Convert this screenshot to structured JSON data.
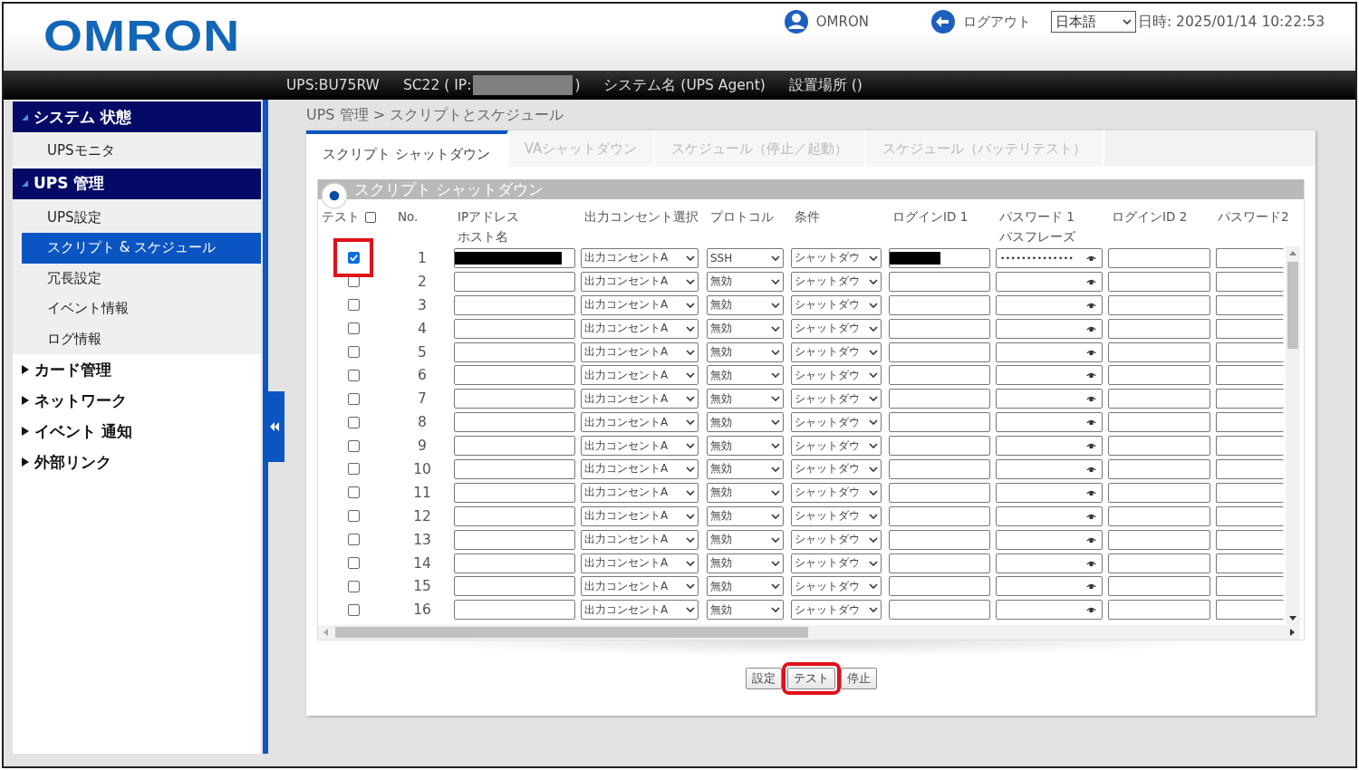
{
  "header": {
    "logo": "OMRON",
    "user": "OMRON",
    "logout": "ログアウト",
    "language": "日本語",
    "datetime": "日時: 2025/01/14 10:22:53"
  },
  "info_bar": {
    "model": "UPS:BU75RW",
    "card_prefix": "SC22 ( IP:",
    "ip_redacted": true,
    "card_suffix": ")",
    "system_name": "システム名 (UPS Agent)",
    "location": "設置場所 ()"
  },
  "sidebar": {
    "sections": [
      {
        "label": "システム 状態",
        "expanded": true,
        "items": [
          {
            "label": "UPSモニタ",
            "selected": false
          }
        ]
      },
      {
        "label": "UPS 管理",
        "expanded": true,
        "items": [
          {
            "label": "UPS設定",
            "selected": false
          },
          {
            "label": "スクリプト & スケジュール",
            "selected": true
          },
          {
            "label": "冗長設定",
            "selected": false
          },
          {
            "label": "イベント情報",
            "selected": false
          },
          {
            "label": "ログ情報",
            "selected": false
          }
        ]
      },
      {
        "label": "カード管理",
        "expanded": false
      },
      {
        "label": "ネットワーク",
        "expanded": false
      },
      {
        "label": "イベント 通知",
        "expanded": false
      },
      {
        "label": "外部リンク",
        "expanded": false
      }
    ]
  },
  "breadcrumb": "UPS 管理 > スクリプトとスケジュール",
  "tabs": [
    {
      "label": "スクリプト シャットダウン",
      "selected": true
    },
    {
      "label": "VAシャットダウン",
      "selected": false
    },
    {
      "label": "スケジュール（停止／起動）",
      "selected": false
    },
    {
      "label": "スケジュール（バッテリテスト）",
      "selected": false
    }
  ],
  "section_title": "スクリプト シャットダウン",
  "table": {
    "columns": [
      {
        "lines": [
          "テスト"
        ],
        "kind": "check"
      },
      {
        "lines": [
          "No."
        ],
        "kind": "no"
      },
      {
        "lines": [
          "IPアドレス",
          "ホスト名"
        ],
        "kind": "ip"
      },
      {
        "lines": [
          "出力コンセント選択"
        ],
        "kind": "outlet"
      },
      {
        "lines": [
          "プロトコル"
        ],
        "kind": "protocol"
      },
      {
        "lines": [
          "条件"
        ],
        "kind": "condition"
      },
      {
        "lines": [
          "ログインID 1"
        ],
        "kind": "login1"
      },
      {
        "lines": [
          "パスワード 1",
          "パスフレーズ"
        ],
        "kind": "password1"
      },
      {
        "lines": [
          "ログインID 2"
        ],
        "kind": "login2"
      },
      {
        "lines": [
          "パスワード2"
        ],
        "kind": "password2"
      }
    ],
    "select_all_checked": false,
    "rows": [
      {
        "no": "1",
        "test": true,
        "highlighted": true,
        "ip_redacted": true,
        "outlet": "出力コンセントA",
        "protocol": "SSH",
        "condition": "シャットダウ",
        "login_redacted": true,
        "password_1": "••••••••••••••"
      },
      {
        "no": "2",
        "test": false,
        "highlighted": false,
        "ip_redacted": false,
        "outlet": "出力コンセントA",
        "protocol": "無効",
        "condition": "シャットダウ",
        "login_redacted": false
      },
      {
        "no": "3",
        "test": false,
        "highlighted": false,
        "ip_redacted": false,
        "outlet": "出力コンセントA",
        "protocol": "無効",
        "condition": "シャットダウ",
        "login_redacted": false
      },
      {
        "no": "4",
        "test": false,
        "highlighted": false,
        "ip_redacted": false,
        "outlet": "出力コンセントA",
        "protocol": "無効",
        "condition": "シャットダウ",
        "login_redacted": false
      },
      {
        "no": "5",
        "test": false,
        "highlighted": false,
        "ip_redacted": false,
        "outlet": "出力コンセントA",
        "protocol": "無効",
        "condition": "シャットダウ",
        "login_redacted": false
      },
      {
        "no": "6",
        "test": false,
        "highlighted": false,
        "ip_redacted": false,
        "outlet": "出力コンセントA",
        "protocol": "無効",
        "condition": "シャットダウ",
        "login_redacted": false
      },
      {
        "no": "7",
        "test": false,
        "highlighted": false,
        "ip_redacted": false,
        "outlet": "出力コンセントA",
        "protocol": "無効",
        "condition": "シャットダウ",
        "login_redacted": false
      },
      {
        "no": "8",
        "test": false,
        "highlighted": false,
        "ip_redacted": false,
        "outlet": "出力コンセントA",
        "protocol": "無効",
        "condition": "シャットダウ",
        "login_redacted": false
      },
      {
        "no": "9",
        "test": false,
        "highlighted": false,
        "ip_redacted": false,
        "outlet": "出力コンセントA",
        "protocol": "無効",
        "condition": "シャットダウ",
        "login_redacted": false
      },
      {
        "no": "10",
        "test": false,
        "highlighted": false,
        "ip_redacted": false,
        "outlet": "出力コンセントA",
        "protocol": "無効",
        "condition": "シャットダウ",
        "login_redacted": false
      },
      {
        "no": "11",
        "test": false,
        "highlighted": false,
        "ip_redacted": false,
        "outlet": "出力コンセントA",
        "protocol": "無効",
        "condition": "シャットダウ",
        "login_redacted": false
      },
      {
        "no": "12",
        "test": false,
        "highlighted": false,
        "ip_redacted": false,
        "outlet": "出力コンセントA",
        "protocol": "無効",
        "condition": "シャットダウ",
        "login_redacted": false
      },
      {
        "no": "13",
        "test": false,
        "highlighted": false,
        "ip_redacted": false,
        "outlet": "出力コンセントA",
        "protocol": "無効",
        "condition": "シャットダウ",
        "login_redacted": false
      },
      {
        "no": "14",
        "test": false,
        "highlighted": false,
        "ip_redacted": false,
        "outlet": "出力コンセントA",
        "protocol": "無効",
        "condition": "シャットダウ",
        "login_redacted": false
      },
      {
        "no": "15",
        "test": false,
        "highlighted": false,
        "ip_redacted": false,
        "outlet": "出力コンセントA",
        "protocol": "無効",
        "condition": "シャットダウ",
        "login_redacted": false
      },
      {
        "no": "16",
        "test": false,
        "highlighted": false,
        "ip_redacted": false,
        "outlet": "出力コンセントA",
        "protocol": "無効",
        "condition": "シャットダウ",
        "login_redacted": false
      }
    ]
  },
  "buttons": [
    {
      "label": "設定",
      "highlighted": false
    },
    {
      "label": "テスト",
      "highlighted": true
    },
    {
      "label": "停止",
      "highlighted": false
    }
  ]
}
